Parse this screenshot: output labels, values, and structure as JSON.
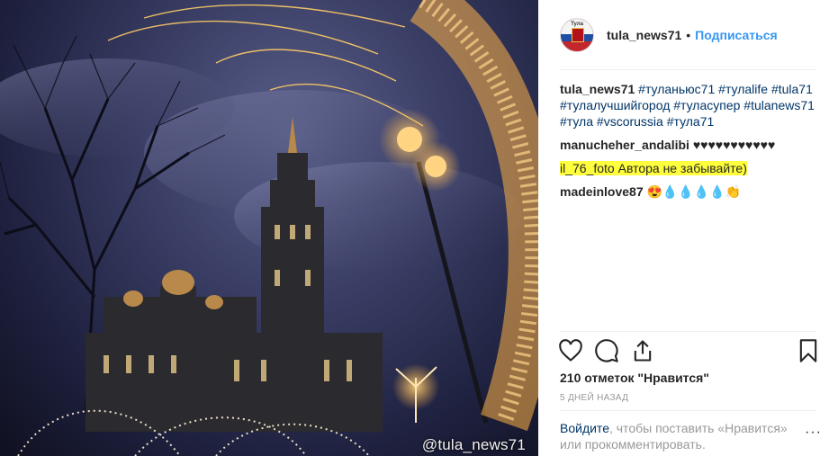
{
  "photo": {
    "watermark": "@tula_news71"
  },
  "post": {
    "username": "tula_news71",
    "separator": "•",
    "follow_label": "Подписаться",
    "avatar_text": "Тула"
  },
  "comments": [
    {
      "user": "tula_news71",
      "tags": [
        "#туланьюс71",
        "#тулаlife",
        "#tula71",
        "#тулалучшийгород",
        "#туласупер",
        "#tulanews71",
        "#тула",
        "#vscorussia",
        "#тула71"
      ]
    },
    {
      "user": "manucheher_andalibi",
      "text": "♥♥♥♥♥♥♥♥♥♥♥"
    },
    {
      "user": "il_76_foto",
      "text": "Автора не забывайте)"
    },
    {
      "user": "madeinlove87",
      "text": "😍💧💧💧💧👏"
    }
  ],
  "actions": {
    "like_icon": "heart-icon",
    "comment_icon": "comment-icon",
    "share_icon": "share-icon",
    "save_icon": "bookmark-icon"
  },
  "likes_text": "210 отметок \"Нравится\"",
  "time_text": "5 ДНЕЙ НАЗАД",
  "login": {
    "link": "Войдите",
    "text": ", чтобы поставить «Нравится» или прокомментировать."
  },
  "more_label": "···",
  "colors": {
    "link": "#003569",
    "follow": "#3897f0",
    "highlight": "#ffff3d"
  }
}
